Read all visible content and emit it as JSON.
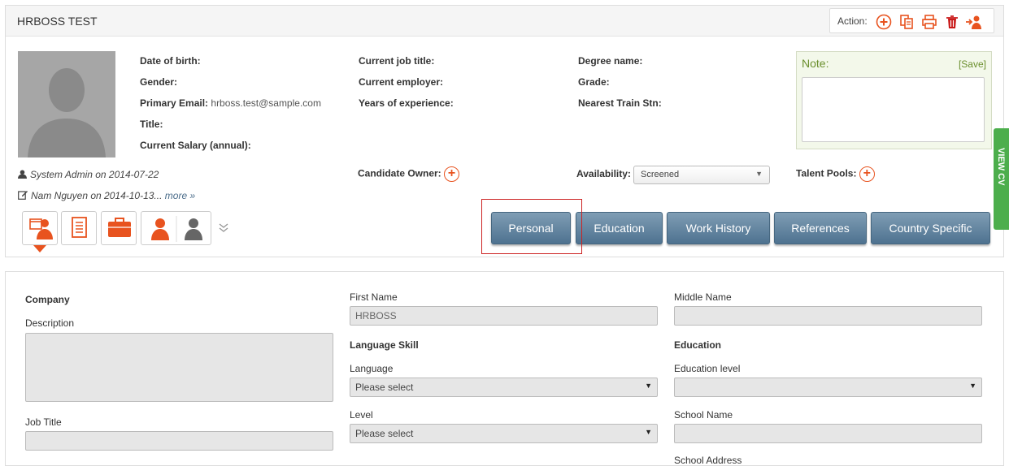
{
  "header": {
    "title": "HRBOSS TEST",
    "action_label": "Action:"
  },
  "profile": {
    "col1": [
      {
        "label": "Date of birth:",
        "value": ""
      },
      {
        "label": "Gender:",
        "value": ""
      },
      {
        "label": "Primary Email:",
        "value": "hrboss.test@sample.com"
      },
      {
        "label": "Title:",
        "value": ""
      },
      {
        "label": "Current Salary (annual):",
        "value": ""
      }
    ],
    "col2": [
      {
        "label": "Current job title:",
        "value": ""
      },
      {
        "label": "Current employer:",
        "value": ""
      },
      {
        "label": "Years of experience:",
        "value": ""
      }
    ],
    "col3": [
      {
        "label": "Degree name:",
        "value": ""
      },
      {
        "label": "Grade:",
        "value": ""
      },
      {
        "label": "Nearest Train Stn:",
        "value": ""
      }
    ]
  },
  "note": {
    "label": "Note:",
    "save": "[Save]",
    "text": ""
  },
  "meta": {
    "created": "System Admin on 2014-07-22",
    "modified": "Nam Nguyen on 2014-10-13...",
    "more": "more »"
  },
  "row2": {
    "candidate_owner": "Candidate Owner:",
    "availability": "Availability:",
    "availability_value": "Screened",
    "talent_pools": "Talent Pools:"
  },
  "tabs": [
    "Personal",
    "Education",
    "Work History",
    "References",
    "Country Specific"
  ],
  "side_tab": "VIEW CV",
  "form": {
    "company": "Company",
    "description": "Description",
    "job_title": "Job Title",
    "first_name_label": "First Name",
    "first_name_value": "HRBOSS",
    "language_skill": "Language Skill",
    "language_label": "Language",
    "language_value": "Please select",
    "level_label": "Level",
    "level_value": "Please select",
    "middle_name_label": "Middle Name",
    "education": "Education",
    "education_level_label": "Education level",
    "school_name_label": "School Name",
    "school_address_label": "School Address"
  },
  "colors": {
    "accent_orange": "#e8531f",
    "tab_blue": "#5b7e9b",
    "note_green": "#6b8f2e",
    "side_green": "#4cae4c",
    "highlight_red": "#cc2222"
  }
}
